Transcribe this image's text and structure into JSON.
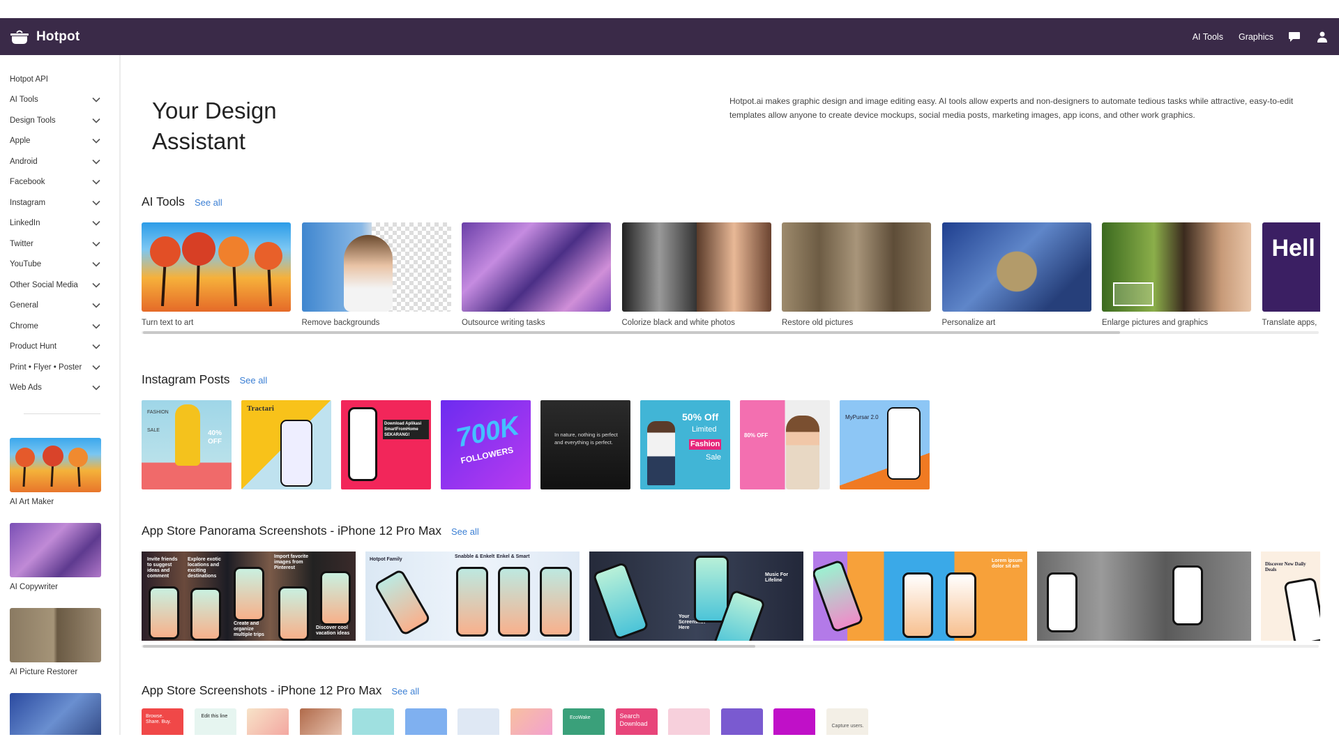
{
  "app": {
    "name": "Hotpot"
  },
  "nav": {
    "links": [
      "AI Tools",
      "Graphics"
    ],
    "icons": [
      "chat-icon",
      "user-icon"
    ]
  },
  "sidebar": {
    "items": [
      {
        "label": "Hotpot API",
        "has_chevron": false
      },
      {
        "label": "AI Tools",
        "has_chevron": true
      },
      {
        "label": "Design Tools",
        "has_chevron": true
      },
      {
        "label": "Apple",
        "has_chevron": true
      },
      {
        "label": "Android",
        "has_chevron": true
      },
      {
        "label": "Facebook",
        "has_chevron": true
      },
      {
        "label": "Instagram",
        "has_chevron": true
      },
      {
        "label": "LinkedIn",
        "has_chevron": true
      },
      {
        "label": "Twitter",
        "has_chevron": true
      },
      {
        "label": "YouTube",
        "has_chevron": true
      },
      {
        "label": "Other Social Media",
        "has_chevron": true
      },
      {
        "label": "General",
        "has_chevron": true
      },
      {
        "label": "Chrome",
        "has_chevron": true
      },
      {
        "label": "Product Hunt",
        "has_chevron": true
      },
      {
        "label": "Print • Flyer • Poster",
        "has_chevron": true
      },
      {
        "label": "Web Ads",
        "has_chevron": true
      }
    ],
    "cards": [
      "AI Art Maker",
      "AI Copywriter",
      "AI Picture Restorer",
      ""
    ]
  },
  "hero": {
    "title_line1": "Your Design",
    "title_line2": "Assistant",
    "description": "Hotpot.ai makes graphic design and image editing easy. AI tools allow experts and non-designers to automate tedious tasks while attractive, easy-to-edit templates allow anyone to create device mockups, social media posts, marketing images, app icons, and other work graphics."
  },
  "sections": {
    "ai_tools": {
      "title": "AI Tools",
      "see_all": "See all",
      "cards": [
        "Turn text to art",
        "Remove backgrounds",
        "Outsource writing tasks",
        "Colorize black and white photos",
        "Restore old pictures",
        "Personalize art",
        "Enlarge pictures and graphics",
        "Translate apps,"
      ],
      "scroll_position": 0.83
    },
    "instagram": {
      "title": "Instagram Posts",
      "see_all": "See all",
      "card_texts": {
        "fashion": "FASHION",
        "sale": "SALE",
        "off40": "40% OFF",
        "tractari": "Tractari",
        "download": "Download Aplikasi SmartFromHome SEKARANG!",
        "followers_num": "700K",
        "followers": "FOLLOWERS",
        "quote": "In nature, nothing is perfect and everything is perfect.",
        "off50": "50% Off",
        "limited": "Limited",
        "fashion2": "Fashion",
        "sale2": "Sale",
        "off80": "80% OFF",
        "mypursar": "MyPursar 2.0"
      }
    },
    "panorama": {
      "title": "App Store Panorama Screenshots - iPhone 12 Pro Max",
      "see_all": "See all",
      "captions": {
        "a1": "Invite friends to suggest ideas and comment",
        "a2": "Explore exotic locations and exciting destinations",
        "a3": "Import favorite images from Pinterest",
        "a4": "Create and organize multiple trips",
        "a5": "Discover cool vacation ideas",
        "b1": "Hotpot Family",
        "b2": "Snabble & Enkelt",
        "b3": "Enkel & Smart",
        "c1": "Your Screenshot Here",
        "c2": "Music For Lifeline",
        "d1": "Lorem ipsum dolor sit am",
        "f1": "Discover New Daily Deals"
      },
      "scroll_position": 0.52
    },
    "appstore": {
      "title": "App Store Screenshots - iPhone 12 Pro Max",
      "see_all": "See all",
      "captions": {
        "s1": "Browse. Share. Buy.",
        "s2": "Edit this line",
        "s9": "EcoWake",
        "s10": "Search Download",
        "s14": "Capture users."
      }
    }
  }
}
